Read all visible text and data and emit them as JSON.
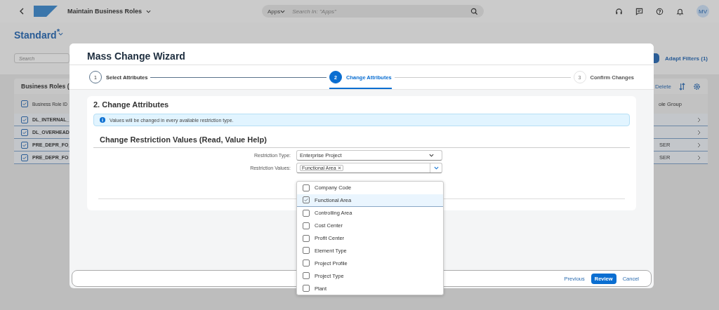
{
  "shell_bar": {
    "app_title": "Maintain Business Roles",
    "search_scope": "Apps",
    "search_placeholder": "Search In: \"Apps\"",
    "avatar": "MV"
  },
  "header": {
    "variant": "Standard$^{*}$"
  },
  "filter_bar": {
    "search_placeholder": "Search",
    "adapt_filters": "Adapt Filters (1)"
  },
  "table": {
    "title": "Business Roles (",
    "delete": "Delete",
    "header_checked": true,
    "column_1": "Business Role ID",
    "column_2": "ole Group",
    "rows": [
      {
        "checked": true,
        "id": "DL_INTERNAL_",
        "group": ""
      },
      {
        "checked": true,
        "id": "DL_OVERHEAD",
        "group": ""
      },
      {
        "checked": true,
        "id": "PRE_DEPR_FO_",
        "group": "SER"
      },
      {
        "checked": true,
        "id": "PRE_DEPR_FO",
        "group": "SER"
      }
    ]
  },
  "dialog": {
    "title": "Mass Change Wizard",
    "steps": [
      {
        "number": "1",
        "label": "Select Attributes",
        "selected": false,
        "disabled": false
      },
      {
        "number": "2",
        "label": "Change Attributes",
        "selected": true,
        "disabled": false
      },
      {
        "number": "3",
        "label": "Confirm Changes",
        "selected": false,
        "disabled": true
      }
    ],
    "section_title": "2. Change Attributes",
    "info": "Values will be changed in every available restriction type.",
    "subsection_title": "Change Restriction Values (Read, Value Help)",
    "restriction_type_label": "Restriction Type:",
    "restriction_type": "Enterprise Project",
    "restriction_values_label": "Restriction Values:",
    "tokens": [
      "Functional Area"
    ],
    "options": [
      {
        "label": "Company Code",
        "checked": false,
        "selected": false
      },
      {
        "label": "Functional Area",
        "checked": true,
        "selected": true
      },
      {
        "label": "Controlling Area",
        "checked": false,
        "selected": false
      },
      {
        "label": "Cost Center",
        "checked": false,
        "selected": false
      },
      {
        "label": "Profit Center",
        "checked": false,
        "selected": false
      },
      {
        "label": "Element Type",
        "checked": false,
        "selected": false
      },
      {
        "label": "Project Profile",
        "checked": false,
        "selected": false
      },
      {
        "label": "Project Type",
        "checked": false,
        "selected": false
      },
      {
        "label": "Plant",
        "checked": false,
        "selected": false
      }
    ],
    "buttons": [
      {
        "label": "Previous",
        "kind": "link"
      },
      {
        "label": "Review",
        "kind": "primary"
      },
      {
        "label": "Cancel",
        "kind": "link"
      }
    ]
  }
}
